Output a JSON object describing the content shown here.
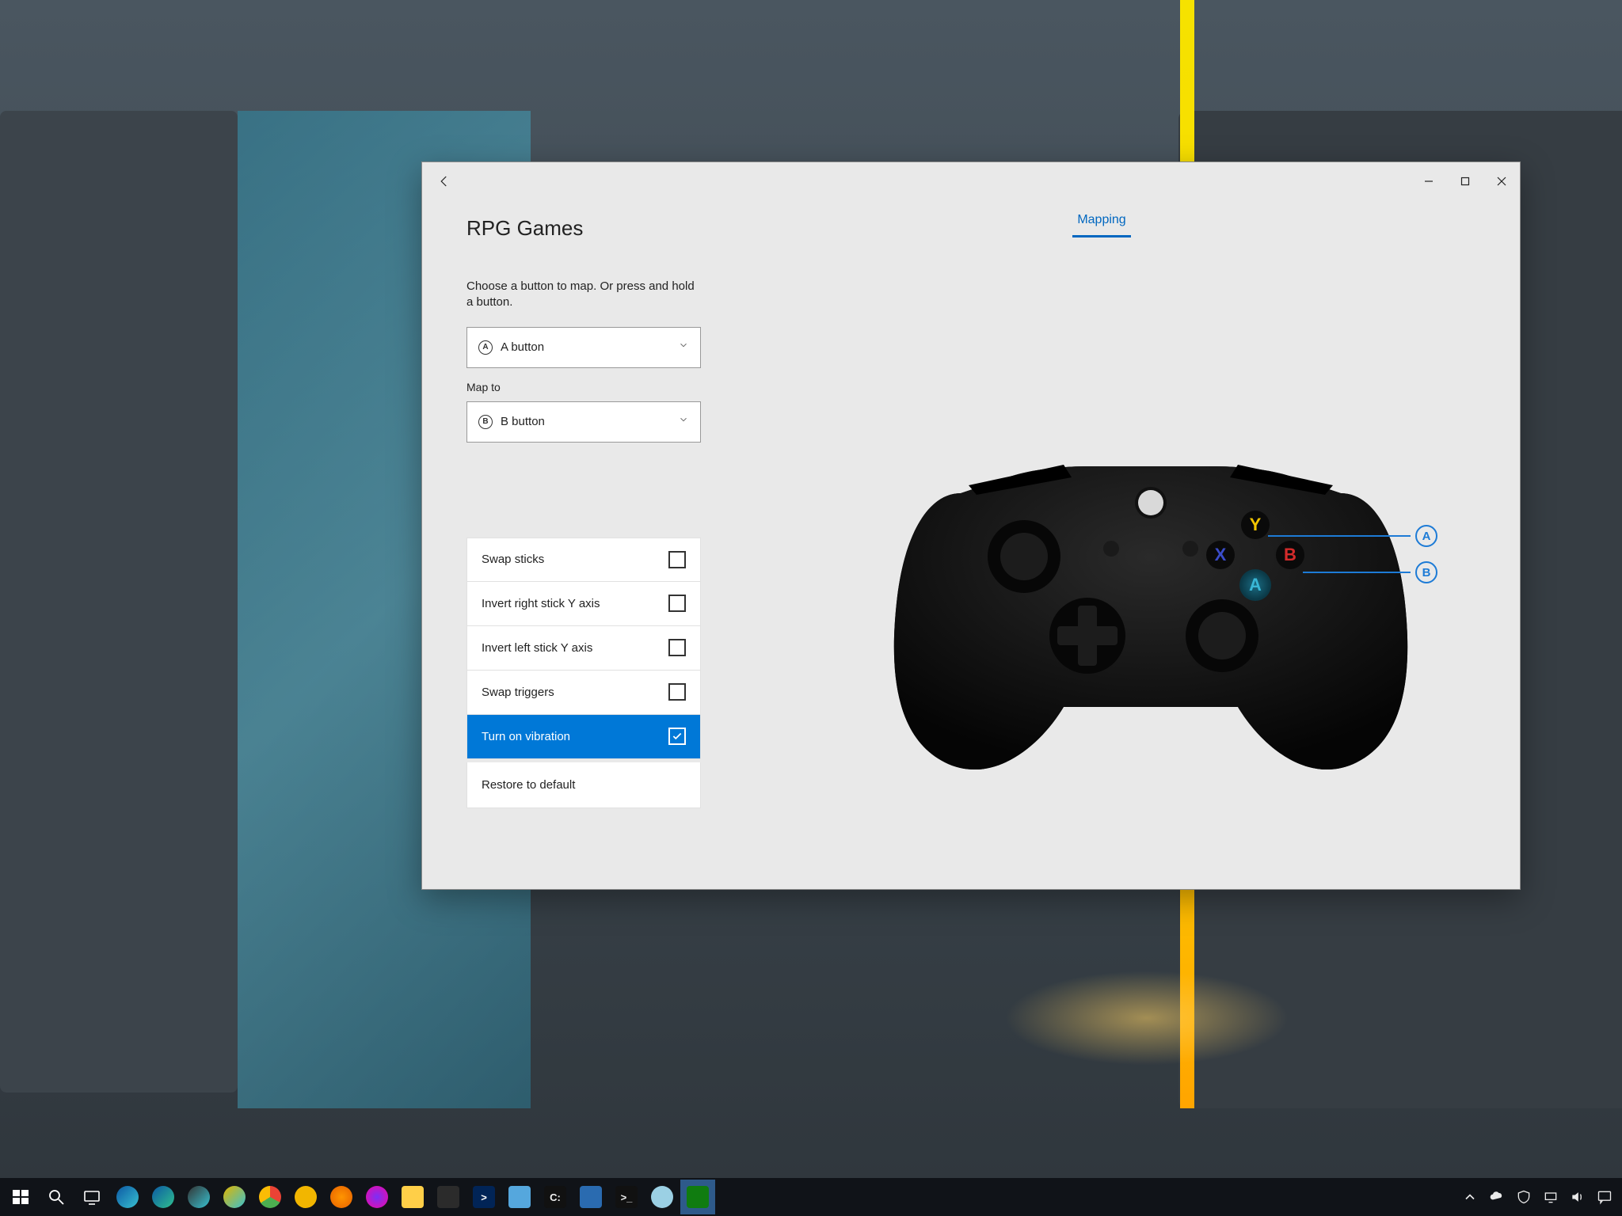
{
  "window": {
    "title": "RPG Games",
    "tab": "Mapping",
    "help": "Choose a button to map. Or press and hold a button.",
    "from_button": "A button",
    "from_letter": "A",
    "map_to_label": "Map to",
    "to_button": "B button",
    "to_letter": "B"
  },
  "options": [
    {
      "label": "Swap sticks",
      "checked": false
    },
    {
      "label": "Invert right stick Y axis",
      "checked": false
    },
    {
      "label": "Invert left stick Y axis",
      "checked": false
    },
    {
      "label": "Swap triggers",
      "checked": false
    },
    {
      "label": "Turn on vibration",
      "checked": true
    }
  ],
  "restore_label": "Restore to default",
  "controller": {
    "buttons": {
      "y": "Y",
      "x": "X",
      "b": "B",
      "a": "A"
    },
    "callouts": {
      "a": "A",
      "b": "B"
    }
  },
  "taskbar": {
    "time": "",
    "date": ""
  }
}
